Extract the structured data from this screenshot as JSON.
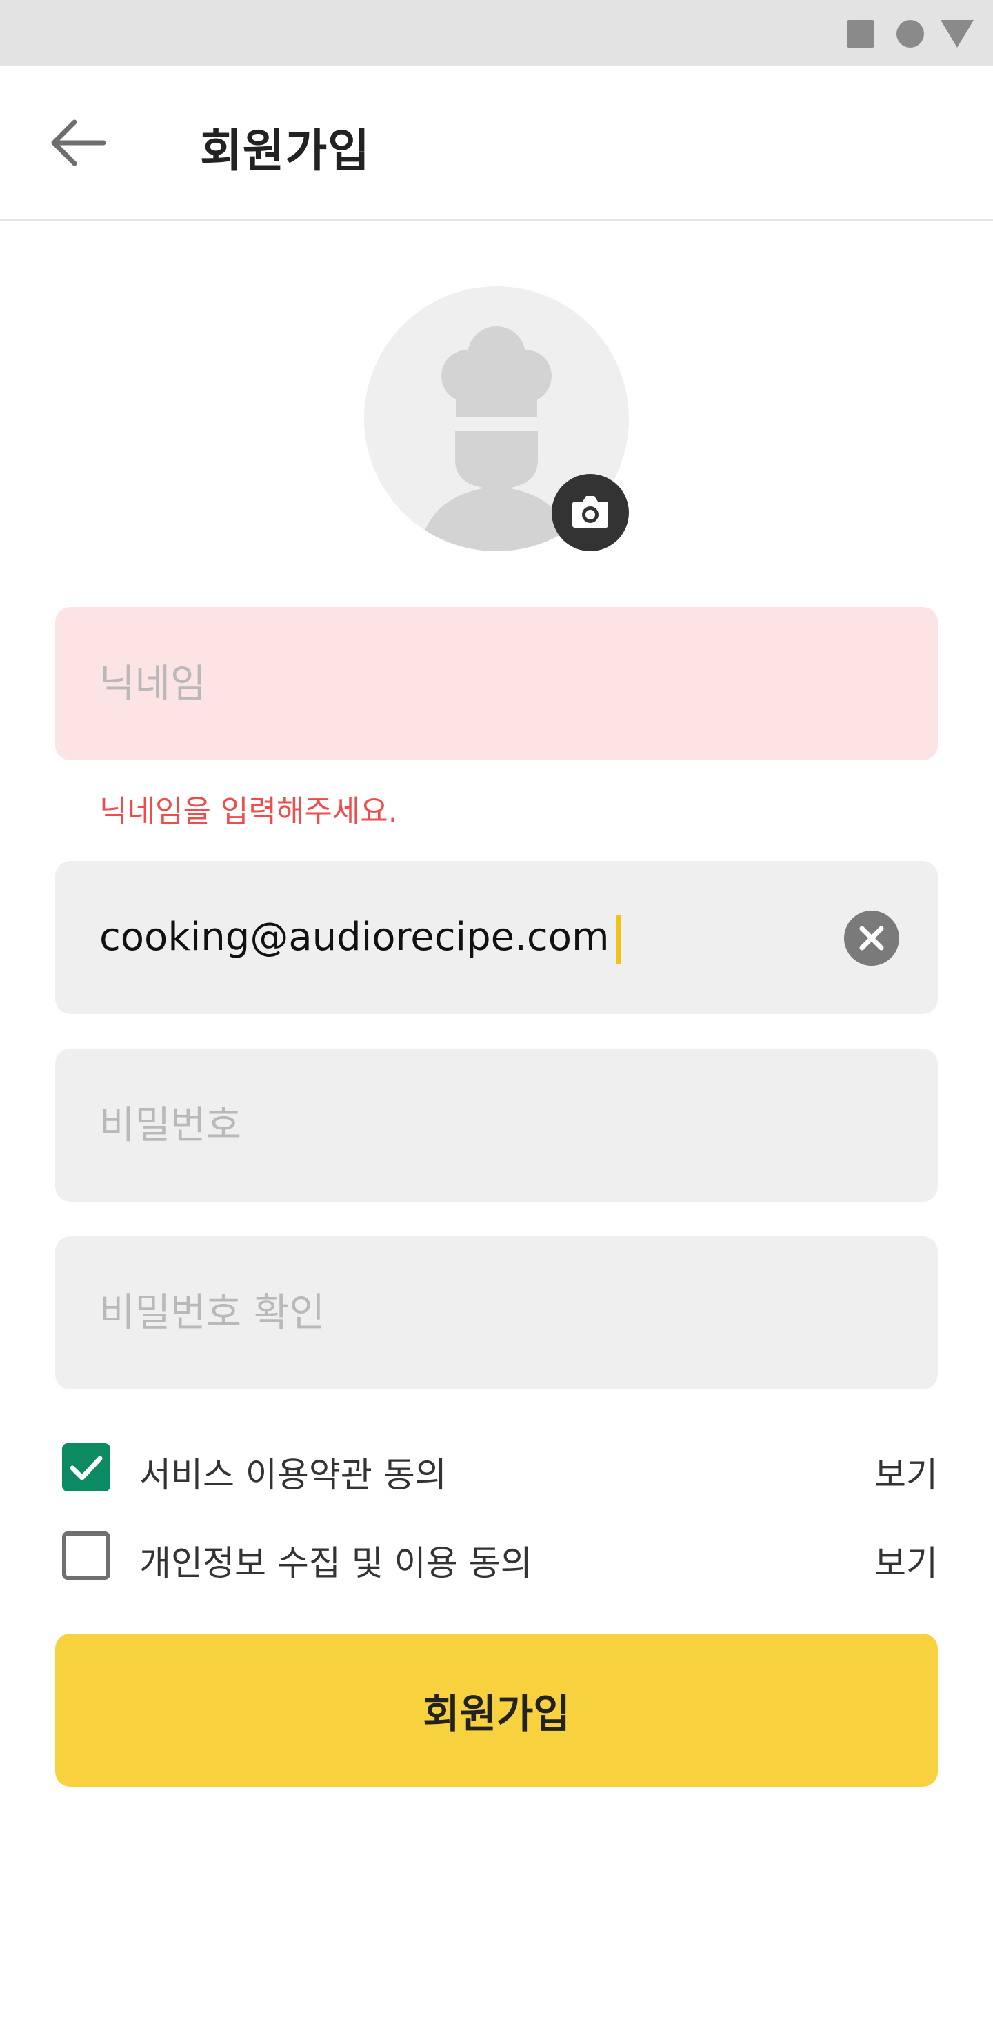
{
  "status_bar": {
    "icons": [
      "square-icon",
      "circle-icon",
      "triangle-icon"
    ]
  },
  "header": {
    "back_icon": "arrow-left-icon",
    "title": "회원가입"
  },
  "profile": {
    "avatar_icon": "chef-avatar-icon",
    "camera_icon": "camera-icon"
  },
  "form": {
    "nickname": {
      "placeholder": "닉네임",
      "value": "",
      "error": "닉네임을 입력해주세요."
    },
    "email": {
      "value": "cooking@audiorecipe.com",
      "clear_icon": "clear-icon"
    },
    "password": {
      "placeholder": "비밀번호"
    },
    "password_confirm": {
      "placeholder": "비밀번호 확인"
    }
  },
  "agreements": [
    {
      "label": "서비스 이용약관 동의",
      "checked": true,
      "view_label": "보기"
    },
    {
      "label": "개인정보 수집 및 이용 동의",
      "checked": false,
      "view_label": "보기"
    }
  ],
  "submit": {
    "label": "회원가입"
  },
  "colors": {
    "accent": "#f8d13f",
    "error": "#ef4d4d",
    "error_bg": "#fde4e4",
    "checkbox_checked": "#0b8a63",
    "caret": "#f2c21b",
    "field_bg": "#efefef"
  }
}
